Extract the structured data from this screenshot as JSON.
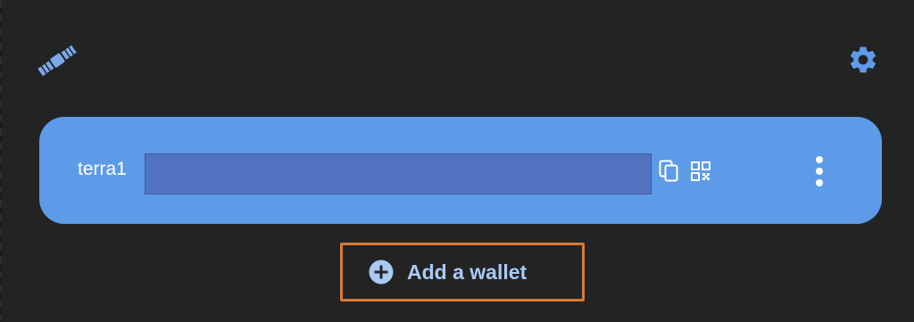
{
  "app": {
    "logo_icon": "satellite-icon",
    "settings_icon": "gear-icon"
  },
  "wallet": {
    "address_prefix": "terra1",
    "copy_icon": "copy-icon",
    "qr_icon": "qr-code-icon",
    "more_icon": "more-vertical-icon"
  },
  "actions": {
    "add_wallet_label": "Add a wallet",
    "add_wallet_icon": "plus-circle-icon"
  },
  "colors": {
    "background": "#232323",
    "card": "#5d9be8",
    "accent": "#a9c9f5",
    "highlight": "#d67a35",
    "redaction": "#5274c0"
  }
}
